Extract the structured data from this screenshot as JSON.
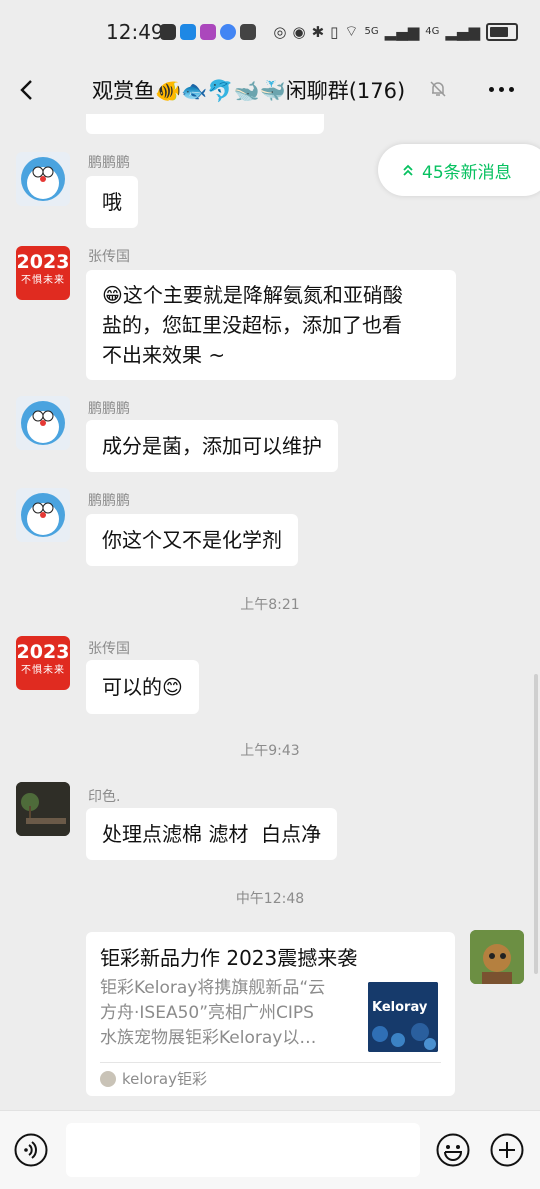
{
  "status_bar": {
    "time": "12:49",
    "signal_1": "5G",
    "signal_2": "4G"
  },
  "header": {
    "title": "观赏鱼🐠🐟🐬🐋🐳闲聊群(176)"
  },
  "new_messages": {
    "label": "45条新消息"
  },
  "messages": [
    {
      "sender": "鹏鹏鹏",
      "text": "哦"
    },
    {
      "sender": "张传国",
      "text_lines": [
        "😁这个主要就是降解氨氮和亚硝酸",
        "盐的，您缸里没超标，添加了也看",
        "不出来效果 ~"
      ]
    },
    {
      "sender": "鹏鹏鹏",
      "text": "成分是菌，添加可以维护"
    },
    {
      "sender": "鹏鹏鹏",
      "text": "你这个又不是化学剂"
    },
    {
      "timestamp": "上午8:21"
    },
    {
      "sender": "张传国",
      "text": "可以的😊"
    },
    {
      "timestamp": "上午9:43"
    },
    {
      "sender": "印色.",
      "text": "处理点滤棉 滤材  白点净"
    },
    {
      "timestamp": "中午12:48"
    }
  ],
  "avatar_2023": {
    "year": "2023",
    "slogan": "不惧未来"
  },
  "link_card": {
    "title": "钜彩新品力作 2023震撼来袭",
    "desc_lines": [
      "钜彩Keloray将携旗舰新品“云",
      "方舟·ISEA50”亮相广州CIPS",
      "水族宠物展钜彩Keloray以…"
    ],
    "thumb_text": "Keloray",
    "source": "keloray钜彩"
  },
  "colors": {
    "accent": "#07c160",
    "background": "#ededed",
    "bubble": "#ffffff"
  }
}
